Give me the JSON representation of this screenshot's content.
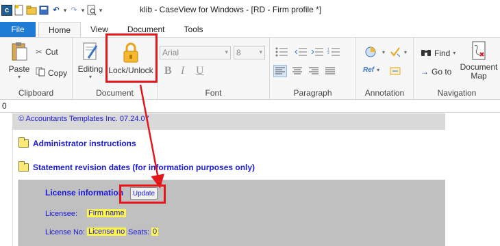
{
  "window": {
    "title": "klib - CaseView for Windows - [RD - Firm profile *]",
    "address_value": "0"
  },
  "tabs": [
    {
      "label": "File"
    },
    {
      "label": "Home"
    },
    {
      "label": "View"
    },
    {
      "label": "Document"
    },
    {
      "label": "Tools"
    }
  ],
  "ribbon": {
    "clipboard": {
      "paste": "Paste",
      "cut": "Cut",
      "copy": "Copy",
      "group": "Clipboard"
    },
    "document": {
      "editing": "Editing",
      "lock_unlock": "Lock/Unlock",
      "group": "Document"
    },
    "font": {
      "font_name": "Arial",
      "font_size": "8",
      "bold": "B",
      "italic": "I",
      "underline": "U",
      "group": "Font"
    },
    "paragraph": {
      "group": "Paragraph"
    },
    "annotation": {
      "ref": "Ref",
      "group": "Annotation"
    },
    "navigation": {
      "find": "Find",
      "goto": "Go to",
      "document_map": "Document Map",
      "group": "Navigation"
    }
  },
  "document": {
    "copyright": "© Accountants Templates Inc. 07.24.07",
    "sections": [
      {
        "label": "Administrator instructions"
      },
      {
        "label": "Statement revision dates (for information purposes only)"
      }
    ],
    "license": {
      "title": "License information",
      "update_label": "Update",
      "licensee_label": "Licensee:",
      "licensee_value": "Firm name",
      "license_no_label": "License No:",
      "license_no_value": "License no",
      "seats_label": "Seats:",
      "seats_value": "0"
    }
  },
  "colors": {
    "file_tab": "#1e7cd4",
    "highlight_box": "#e3161b",
    "link_text": "#1a1ad8",
    "field_highlight": "#fff64d",
    "panel_gray": "#c0c0c0"
  }
}
